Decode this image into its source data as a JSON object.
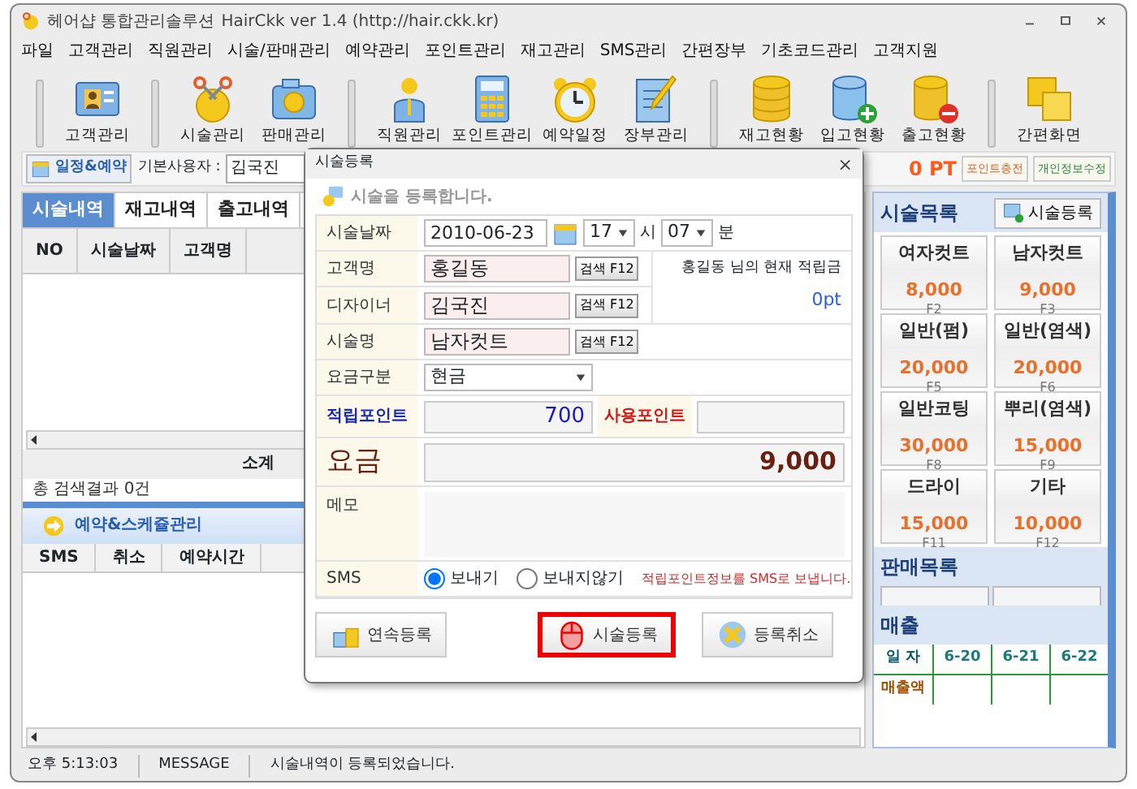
{
  "window": {
    "title": "헤어샵 통합관리솔루션",
    "subtitle": "HairCkk ver 1.4 (http://hair.ckk.kr)"
  },
  "menu": [
    "파일",
    "고객관리",
    "직원관리",
    "시술/판매관리",
    "예약관리",
    "포인트관리",
    "재고관리",
    "SMS관리",
    "간편장부",
    "기초코드관리",
    "고객지원"
  ],
  "toolbar": [
    [
      {
        "label": "고객관리",
        "kind": "card"
      }
    ],
    [
      {
        "label": "시술관리",
        "kind": "scissors"
      },
      {
        "label": "판매관리",
        "kind": "camera"
      }
    ],
    [
      {
        "label": "직원관리",
        "kind": "person"
      },
      {
        "label": "포인트관리",
        "kind": "calculator"
      },
      {
        "label": "예약일정",
        "kind": "clock"
      },
      {
        "label": "장부관리",
        "kind": "notepad"
      }
    ],
    [
      {
        "label": "재고현황",
        "kind": "database"
      },
      {
        "label": "입고현황",
        "kind": "dbadd"
      },
      {
        "label": "출고현황",
        "kind": "dbremove"
      }
    ],
    [
      {
        "label": "간편화면",
        "kind": "windows"
      }
    ]
  ],
  "info_bar": {
    "schedule_button": "일정&예약",
    "user_label": "기본사용자 :",
    "user_value": "김국진",
    "points": "0 PT",
    "buttons": [
      "포인트충전",
      "개인정보수정"
    ]
  },
  "history": {
    "tabs": [
      {
        "label": "시술내역",
        "selected": true
      },
      {
        "label": "재고내역",
        "selected": false
      },
      {
        "label": "출고내역",
        "selected": false
      }
    ],
    "columns": [
      "NO",
      "시술날짜",
      "고객명"
    ],
    "subtotal": "소계",
    "result": "총 검색결과 0건"
  },
  "schedule": {
    "title": "예약&스케쥴관리",
    "columns": [
      "SMS",
      "취소",
      "예약시간"
    ]
  },
  "services": {
    "title": "시술목록",
    "register_button": "시술등록",
    "items": [
      {
        "name": "여자컷트",
        "price": "8,000",
        "key": "F2"
      },
      {
        "name": "남자컷트",
        "price": "9,000",
        "key": "F3"
      },
      {
        "name": "일반(펌)",
        "price": "20,000",
        "key": "F5"
      },
      {
        "name": "일반(염색)",
        "price": "20,000",
        "key": "F6"
      },
      {
        "name": "일반코팅",
        "price": "30,000",
        "key": "F8"
      },
      {
        "name": "뿌리(염색)",
        "price": "15,000",
        "key": "F9"
      },
      {
        "name": "드라이",
        "price": "15,000",
        "key": "F11"
      },
      {
        "name": "기타",
        "price": "10,000",
        "key": "F12"
      }
    ]
  },
  "sales_list": {
    "title": "판매목록"
  },
  "revenue": {
    "title": "매출",
    "columns": [
      "일 자",
      "6-20",
      "6-21",
      "6-22"
    ],
    "row_label": "매출액"
  },
  "status_bar": [
    "오후 5:13:03",
    "MESSAGE",
    "시술내역이 등록되었습니다."
  ],
  "dialog": {
    "title": "시술등록",
    "close_glyph": "×",
    "intro": "시술을 등록합니다.",
    "date": {
      "label": "시술날짜",
      "value": "2010-06-23",
      "hour": "17",
      "hour_unit": "시",
      "minute": "07",
      "minute_unit": "분"
    },
    "customer": {
      "label": "고객명",
      "value": "홍길동",
      "button": "검색 F12"
    },
    "designer": {
      "label": "디자이너",
      "value": "김국진",
      "button": "검색 F12"
    },
    "balance": {
      "text": "홍길동 님의 현재 적립금",
      "value": "0pt"
    },
    "service": {
      "label": "시술명",
      "value": "남자컷트",
      "button": "검색 F12"
    },
    "payment": {
      "label": "요금구분",
      "value": "현금"
    },
    "earn_points": {
      "label": "적립포인트",
      "value": "700"
    },
    "use_points": {
      "label": "사용포인트"
    },
    "fee": {
      "label": "요금",
      "value": "9,000"
    },
    "memo": {
      "label": "메모"
    },
    "sms": {
      "label": "SMS",
      "options": [
        {
          "label": "보내기",
          "selected": true
        },
        {
          "label": "보내지않기",
          "selected": false
        }
      ],
      "note": "적립포인트정보를 SMS로 보냅니다."
    },
    "buttons": [
      {
        "label": "연속등록",
        "kind": "repeat",
        "highlighted": false
      },
      {
        "label": "시술등록",
        "kind": "register",
        "highlighted": true
      },
      {
        "label": "등록취소",
        "kind": "cancel",
        "highlighted": false
      }
    ]
  }
}
